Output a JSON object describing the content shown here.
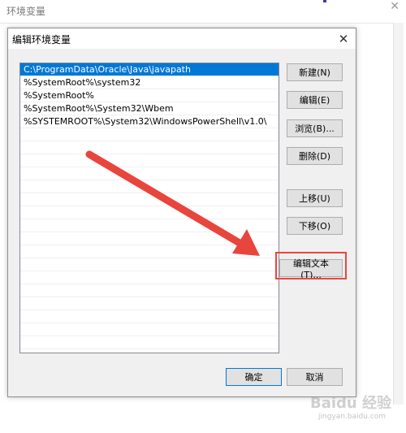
{
  "background_window": {
    "title": "环境变量",
    "close_glyph": "✕"
  },
  "dialog": {
    "title": "编辑环境变量",
    "close_glyph": "✕",
    "path_entries": [
      "C:\\ProgramData\\Oracle\\Java\\javapath",
      "%SystemRoot%\\system32",
      "%SystemRoot%",
      "%SystemRoot%\\System32\\Wbem",
      "%SYSTEMROOT%\\System32\\WindowsPowerShell\\v1.0\\"
    ],
    "selected_index": 0,
    "buttons": {
      "new": "新建(N)",
      "edit": "编辑(E)",
      "browse": "浏览(B)...",
      "delete": "删除(D)",
      "move_up": "上移(U)",
      "move_down": "下移(O)",
      "edit_text": "编辑文本(T)...",
      "ok": "确定",
      "cancel": "取消"
    }
  },
  "annotation": {
    "arrow_color": "#e8453c",
    "highlight_color": "#e8453c"
  },
  "watermark": {
    "brand": "Baidu 经验",
    "sub": "jingyan.baidu.com"
  }
}
